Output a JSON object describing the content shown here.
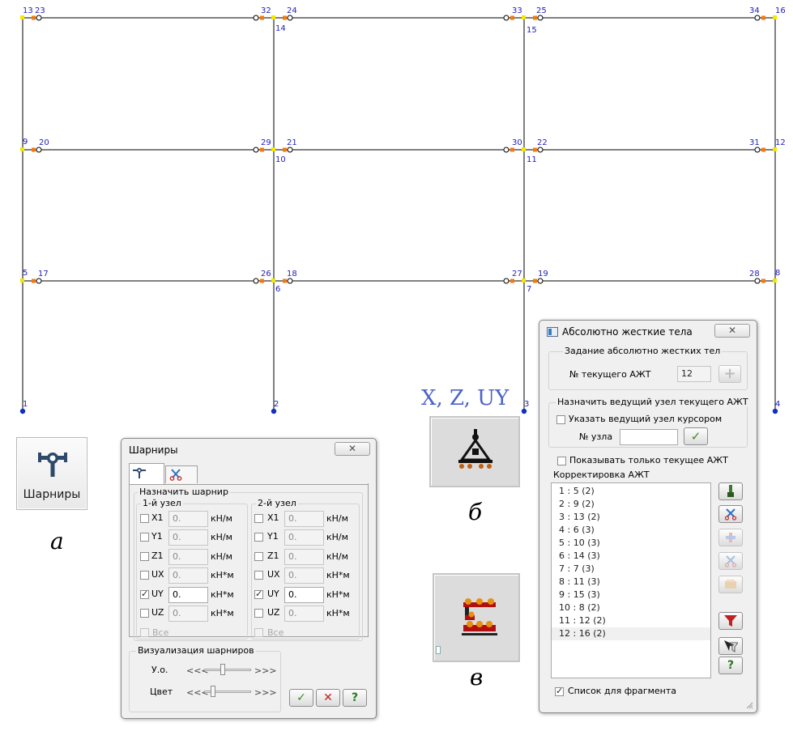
{
  "frame": {
    "node_labels": [
      "1",
      "2",
      "3",
      "4",
      "5",
      "6",
      "7",
      "8",
      "9",
      "10",
      "11",
      "12",
      "13",
      "14",
      "15",
      "16",
      "17",
      "18",
      "19",
      "20",
      "21",
      "22",
      "23",
      "24",
      "25",
      "26",
      "27",
      "28",
      "29",
      "30",
      "31",
      "32",
      "33",
      "34"
    ]
  },
  "colors": {
    "frame_line": "#000000",
    "node_label": "#2020c0",
    "rigid_end_yellow": "#f2e800",
    "rigid_end_orange": "#f07a10",
    "support": "#1030c0"
  },
  "hinge_button": {
    "label": "Шарниры",
    "icon": "hinge-icon",
    "caption": "а"
  },
  "dof_text": "X, Z, UY",
  "caption_b": "б",
  "caption_c": "в",
  "hinges_dialog": {
    "title": "Шарниры",
    "close": "✕",
    "tabs": [
      "hinge-tab-icon",
      "scissors-tab-icon"
    ],
    "assign_group": "Назначить шарнир",
    "node1_label": "1-й узел",
    "node2_label": "2-й узел",
    "dofs": [
      {
        "name": "X1",
        "checked": false,
        "value": "0.",
        "unit": "кН/м"
      },
      {
        "name": "Y1",
        "checked": false,
        "value": "0.",
        "unit": "кН/м"
      },
      {
        "name": "Z1",
        "checked": false,
        "value": "0.",
        "unit": "кН/м"
      },
      {
        "name": "UX",
        "checked": false,
        "value": "0.",
        "unit": "кН*м"
      },
      {
        "name": "UY",
        "checked": true,
        "value": "0.",
        "unit": "кН*м"
      },
      {
        "name": "UZ",
        "checked": false,
        "value": "0.",
        "unit": "кН*м"
      }
    ],
    "all_label": "Все",
    "viz_group": "Визуализация шарниров",
    "angle_label": "У.о.",
    "color_label": "Цвет",
    "slider_left": "<<<",
    "slider_right": ">>>",
    "buttons": [
      "ok-icon",
      "cancel-icon",
      "help-icon"
    ],
    "help_text": "?"
  },
  "rigid_dialog": {
    "title": "Абсолютно жесткие тела",
    "close": "✕",
    "group1_label": "Задание абсолютно жестких тел",
    "current_label": "№ текущего АЖТ",
    "current_value": "12",
    "add_text": "+",
    "group2_label": "Назначить ведущий узел текущего АЖТ",
    "cursor_label": "Указать ведущий узел курсором",
    "node_no_label": "№ узла",
    "node_no_value": "",
    "apply_text": "✓",
    "show_only_label": "Показывать только текущее АЖТ",
    "list_label": "Корректировка АЖТ",
    "items": [
      "1 : 5 (2)",
      "2 : 9 (2)",
      "3 : 13 (2)",
      "4 : 6 (3)",
      "5 : 10 (3)",
      "6 : 14 (3)",
      "7 : 7 (3)",
      "8 : 11 (3)",
      "9 : 15 (3)",
      "10 : 8 (2)",
      "11 : 12 (2)",
      "12 : 16 (2)"
    ],
    "fragment_label": "Список для фрагмента",
    "side_buttons": [
      "brush-icon",
      "scissors-icon",
      "add-disabled-icon",
      "scissors-disabled-icon",
      "eraser-disabled-icon",
      "filter-icon",
      "cursor-filter-icon",
      "help-icon"
    ],
    "help_text": "?"
  }
}
